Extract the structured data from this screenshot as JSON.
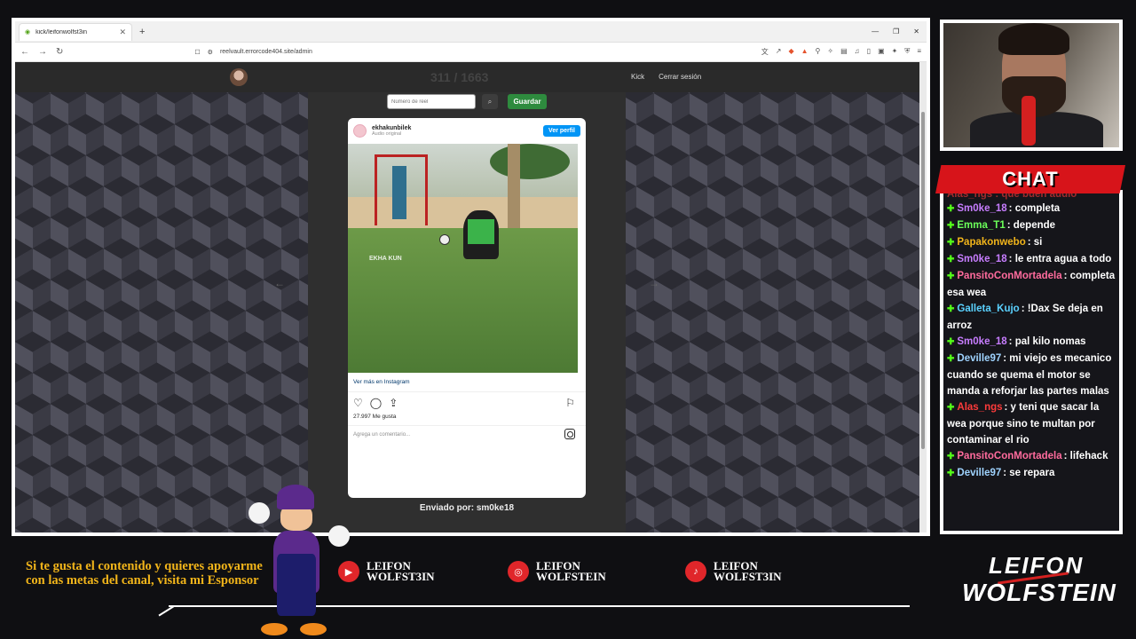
{
  "browser": {
    "tab_title": "kick/leifonwolfst3in",
    "url": "reelvault.errorcode404.site/admin"
  },
  "site": {
    "title": "311 / 1663",
    "nav": [
      "Kick",
      "Cerrar sesión"
    ],
    "reel_placeholder": "Número de reel",
    "save_label": "Guardar",
    "sent_by": "Enviado por: sm0ke18"
  },
  "instagram": {
    "username": "ekhakunbilek",
    "audio": "Audio original",
    "profile_btn": "Ver perfil",
    "watermark": "EKHA KUN",
    "more_link": "Ver más en Instagram",
    "likes": "27.997 Me gusta",
    "comment_placeholder": "Agrega un comentario..."
  },
  "chat": {
    "title": "CHAT",
    "top_partial": "Alas_ngs : que buen audio",
    "messages": [
      {
        "user": "Sm0ke_18",
        "color": "#c77dff",
        "text": ": completa"
      },
      {
        "user": "Emma_T1",
        "color": "#6bff5a",
        "text": ": depende"
      },
      {
        "user": "Papakonwebo",
        "color": "#f2b51a",
        "text": ": si"
      },
      {
        "user": "Sm0ke_18",
        "color": "#c77dff",
        "text": ": le entra agua a todo"
      },
      {
        "user": "PansitoConMortadela",
        "color": "#ff6b9d",
        "text": ": completa esa wea"
      },
      {
        "user": "Galleta_Kujo",
        "color": "#5ad1ff",
        "text": ": !Dax Se deja en arroz"
      },
      {
        "user": "Sm0ke_18",
        "color": "#c77dff",
        "text": ": pal kilo nomas"
      },
      {
        "user": "Deville97",
        "color": "#9fd3ff",
        "text": ": mi viejo es mecanico cuando se quema el motor se manda a reforjar las partes malas"
      },
      {
        "user": "Alas_ngs",
        "color": "#ff3b3b",
        "text": ": y teni que sacar la wea porque sino te multan por contaminar el rio"
      },
      {
        "user": "PansitoConMortadela",
        "color": "#ff6b9d",
        "text": ": lifehack"
      },
      {
        "user": "Deville97",
        "color": "#9fd3ff",
        "text": ": se repara"
      }
    ]
  },
  "banner": {
    "promo": "Si te gusta el contenido y quieres apoyarme con las metas del canal, visita mi Esponsor",
    "socials": [
      {
        "icon": "youtube-icon",
        "line1": "LEIFON",
        "line2": "WOLFST3IN"
      },
      {
        "icon": "instagram-icon",
        "line1": "LEIFON",
        "line2": "WOLFSTEIN"
      },
      {
        "icon": "tiktok-icon",
        "line1": "LEIFON",
        "line2": "WOLFST3IN"
      }
    ],
    "logo_line1": "LEIFON",
    "logo_line2": "WOLFSTEIN"
  }
}
